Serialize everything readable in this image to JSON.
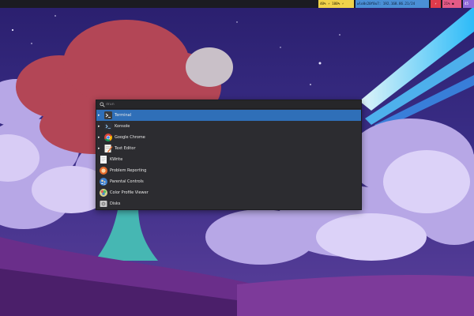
{
  "statusbar": {
    "battery": "40% ⚡ 100% ⚡",
    "network": "wlo0s20f0u7: 192.168.86.21/24",
    "alert": "⚡",
    "status": "21% ●",
    "workspace": "45"
  },
  "launcher": {
    "search_placeholder": "drun",
    "apps": [
      {
        "label": "Terminal",
        "icon": "terminal-icon",
        "chevron": true,
        "selected": true
      },
      {
        "label": "Konsole",
        "icon": "konsole-icon",
        "chevron": true,
        "selected": false
      },
      {
        "label": "Google Chrome",
        "icon": "chrome-icon",
        "chevron": true,
        "selected": false
      },
      {
        "label": "Text Editor",
        "icon": "text-editor-icon",
        "chevron": true,
        "selected": false
      },
      {
        "label": "KWrite",
        "icon": "kwrite-icon",
        "chevron": false,
        "selected": false
      },
      {
        "label": "Problem Reporting",
        "icon": "problem-reporting-icon",
        "chevron": false,
        "selected": false
      },
      {
        "label": "Parental Controls",
        "icon": "parental-controls-icon",
        "chevron": false,
        "selected": false
      },
      {
        "label": "Color Profile Viewer",
        "icon": "color-profile-icon",
        "chevron": false,
        "selected": false
      },
      {
        "label": "Disks",
        "icon": "disks-icon",
        "chevron": false,
        "selected": false
      }
    ]
  },
  "colors": {
    "selection": "#2f6fb8",
    "panel": "#2c2c30",
    "topbar": "#1b1b22"
  }
}
